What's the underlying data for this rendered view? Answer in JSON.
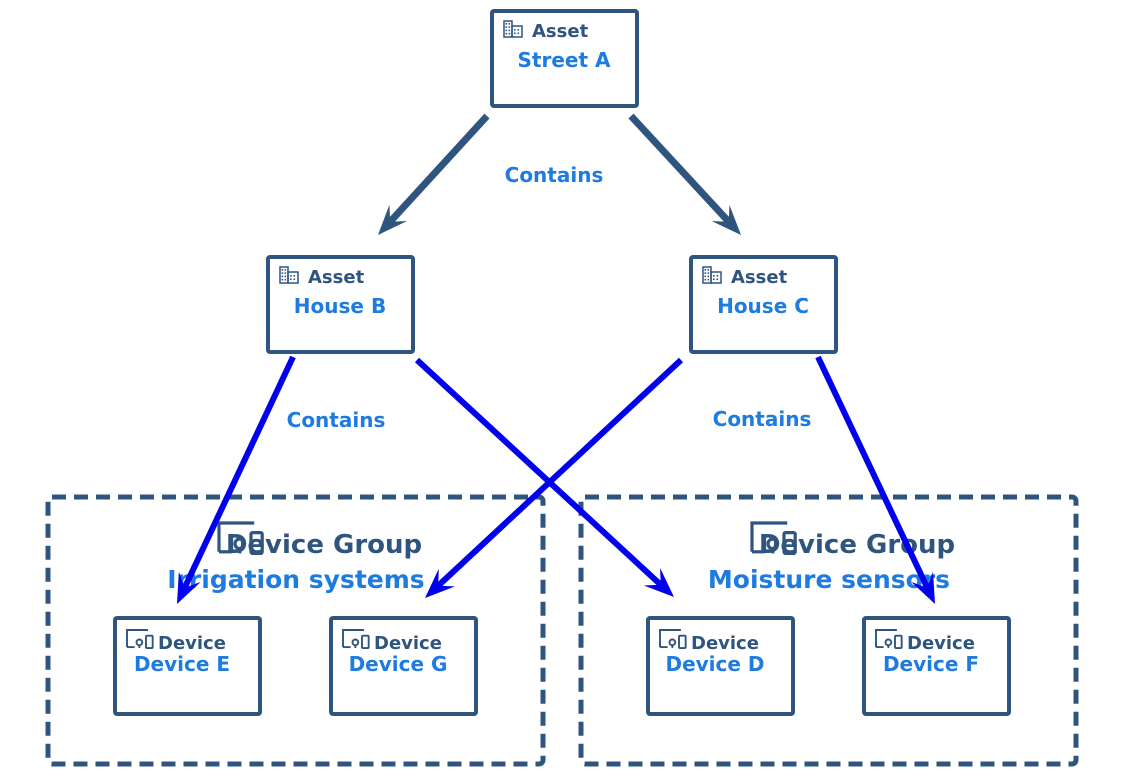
{
  "colors": {
    "node_border": "#2f557f",
    "title_text": "#1e7be0",
    "edge_dark": "#2f557f",
    "edge_blue": "#0000ee"
  },
  "assets": [
    {
      "id": "a",
      "kind": "Asset",
      "title": "Street A",
      "icon": "building-icon"
    },
    {
      "id": "b",
      "kind": "Asset",
      "title": "House B",
      "icon": "building-icon"
    },
    {
      "id": "c",
      "kind": "Asset",
      "title": "House C",
      "icon": "building-icon"
    }
  ],
  "groups": [
    {
      "id": "g1",
      "kind": "Device Group",
      "title": "Irrigation systems",
      "icon": "device-group-icon"
    },
    {
      "id": "g2",
      "kind": "Device Group",
      "title": "Moisture sensors",
      "icon": "device-group-icon"
    }
  ],
  "devices": [
    {
      "id": "e",
      "kind": "Device",
      "title": "Device E",
      "icon": "device-icon"
    },
    {
      "id": "g",
      "kind": "Device",
      "title": "Device G",
      "icon": "device-icon"
    },
    {
      "id": "d",
      "kind": "Device",
      "title": "Device D",
      "icon": "device-icon"
    },
    {
      "id": "f",
      "kind": "Device",
      "title": "Device F",
      "icon": "device-icon"
    }
  ],
  "edges": [
    {
      "from": "a",
      "to": "b",
      "style": "dark"
    },
    {
      "from": "a",
      "to": "c",
      "style": "dark"
    },
    {
      "from": "b",
      "to": "e",
      "style": "blue"
    },
    {
      "from": "b",
      "to": "d",
      "style": "blue"
    },
    {
      "from": "c",
      "to": "g",
      "style": "blue"
    },
    {
      "from": "c",
      "to": "f",
      "style": "blue"
    }
  ],
  "edge_labels": [
    "Contains",
    "Contains",
    "Contains"
  ]
}
